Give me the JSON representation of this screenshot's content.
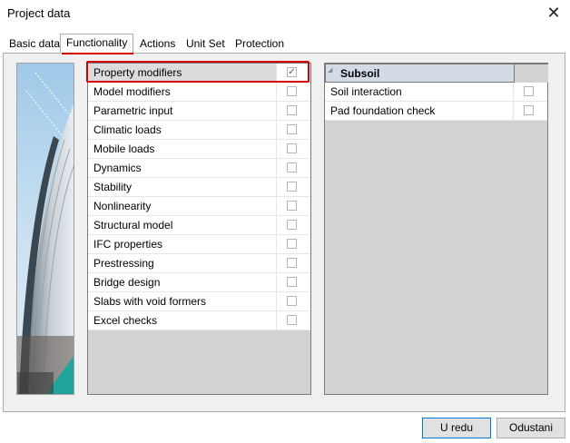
{
  "window": {
    "title": "Project data"
  },
  "tabs": [
    {
      "label": "Basic data"
    },
    {
      "label": "Functionality"
    },
    {
      "label": "Actions"
    },
    {
      "label": "Unit Set"
    },
    {
      "label": "Protection"
    }
  ],
  "functionality": {
    "items": [
      {
        "label": "Property modifiers",
        "checked": true
      },
      {
        "label": "Model modifiers",
        "checked": false
      },
      {
        "label": "Parametric input",
        "checked": false
      },
      {
        "label": "Climatic loads",
        "checked": false
      },
      {
        "label": "Mobile loads",
        "checked": false
      },
      {
        "label": "Dynamics",
        "checked": false
      },
      {
        "label": "Stability",
        "checked": false
      },
      {
        "label": "Nonlinearity",
        "checked": false
      },
      {
        "label": "Structural model",
        "checked": false
      },
      {
        "label": "IFC properties",
        "checked": false
      },
      {
        "label": "Prestressing",
        "checked": false
      },
      {
        "label": "Bridge design",
        "checked": false
      },
      {
        "label": "Slabs with void formers",
        "checked": false
      },
      {
        "label": "Excel checks",
        "checked": false
      }
    ]
  },
  "subsoil": {
    "header": "Subsoil",
    "items": [
      {
        "label": "Soil interaction",
        "checked": false
      },
      {
        "label": "Pad foundation check",
        "checked": false
      }
    ]
  },
  "buttons": {
    "ok": "U redu",
    "cancel": "Odustani"
  },
  "colors": {
    "highlight": "#d40000",
    "header_bg": "#d3dce6",
    "selected_bg": "#dcdcdc"
  }
}
